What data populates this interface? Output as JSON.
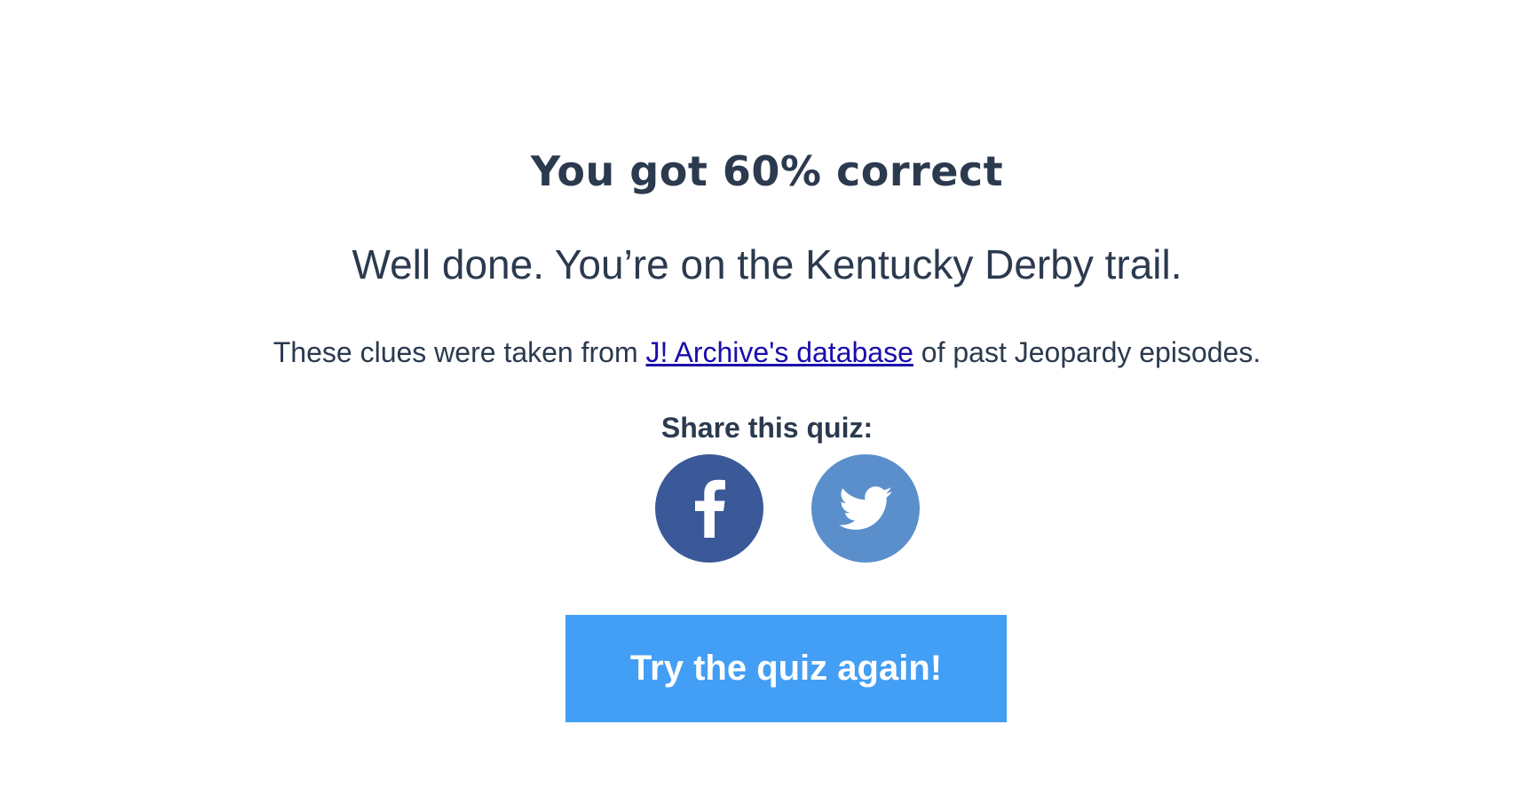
{
  "result": {
    "score_text": "You got 60% correct",
    "message": "Well done. You’re on the Kentucky Derby trail.",
    "source": {
      "before": "These clues were taken from ",
      "link_text": "J! Archive's database",
      "after": " of past Jeopardy episodes."
    }
  },
  "share": {
    "label": "Share this quiz:",
    "buttons": [
      {
        "network": "facebook",
        "icon": "facebook-icon",
        "color": "#3b5998"
      },
      {
        "network": "twitter",
        "icon": "twitter-icon",
        "color": "#5b8fcc"
      }
    ]
  },
  "retry": {
    "label": "Try the quiz again!",
    "color": "#439ef5"
  },
  "colors": {
    "text": "#2b3a4e",
    "link": "#1a0dab",
    "background": "#ffffff"
  }
}
